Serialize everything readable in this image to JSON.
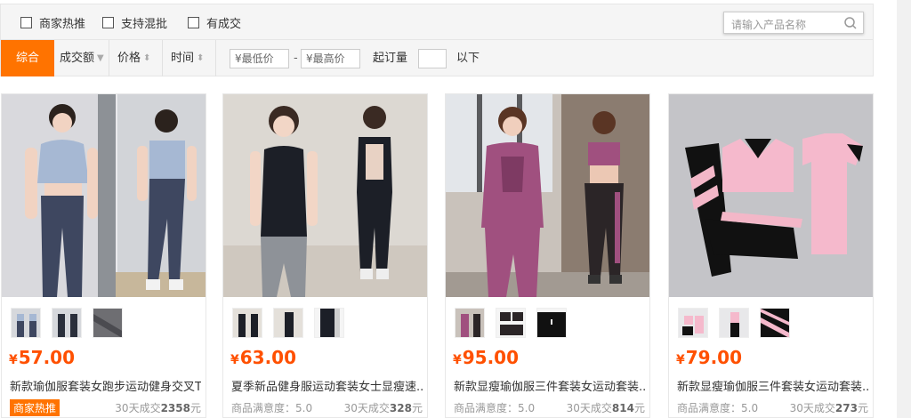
{
  "filters": {
    "checkboxes": [
      {
        "label": "商家热推"
      },
      {
        "label": "支持混批"
      },
      {
        "label": "有成交"
      }
    ],
    "search_placeholder": "请输入产品名称"
  },
  "sort": {
    "active": "综合",
    "items": [
      {
        "label": "成交额"
      },
      {
        "label": "价格"
      },
      {
        "label": "时间"
      }
    ],
    "price_min_placeholder": "¥最低价",
    "price_sep": "-",
    "price_max_placeholder": "¥最高价",
    "min_order_label": "起订量",
    "below_label": "以下"
  },
  "colors": {
    "accent": "#ff7300",
    "price": "#ff5000"
  },
  "products": [
    {
      "price": "57.00",
      "currency": "¥",
      "title": "新款瑜伽服套装女跑步运动健身交叉T...",
      "badge": "商家热推",
      "satisfaction": "",
      "sales_label": "30天成交",
      "sales_value": "2358",
      "sales_unit": "元"
    },
    {
      "price": "63.00",
      "currency": "¥",
      "title": "夏季新品健身服运动套装女士显瘦速...",
      "badge": "",
      "satisfaction": "商品满意度：5.0",
      "sales_label": "30天成交",
      "sales_value": "328",
      "sales_unit": "元"
    },
    {
      "price": "95.00",
      "currency": "¥",
      "title": "新款显瘦瑜伽服三件套装女运动套装...",
      "badge": "",
      "satisfaction": "商品满意度：5.0",
      "sales_label": "30天成交",
      "sales_value": "814",
      "sales_unit": "元"
    },
    {
      "price": "79.00",
      "currency": "¥",
      "title": "新款显瘦瑜伽服三件套装女运动套装...",
      "badge": "",
      "satisfaction": "商品满意度：5.0",
      "sales_label": "30天成交",
      "sales_value": "273",
      "sales_unit": "元"
    }
  ]
}
